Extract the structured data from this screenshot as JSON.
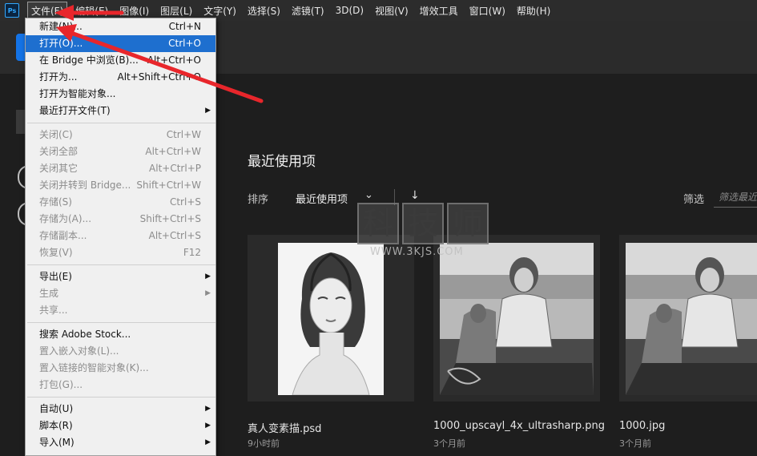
{
  "app": {
    "logo": "Ps"
  },
  "menubar": [
    "文件(F)",
    "编辑(E)",
    "图像(I)",
    "图层(L)",
    "文字(Y)",
    "选择(S)",
    "滤镜(T)",
    "3D(D)",
    "视图(V)",
    "增效工具",
    "窗口(W)",
    "帮助(H)"
  ],
  "home": {
    "section_title": "最近使用项",
    "sort_label": "排序",
    "sort_value": "最近使用项",
    "filter_label": "筛选",
    "filter_placeholder": "筛选最近"
  },
  "files": [
    {
      "name": "真人变素描.psd",
      "time": "9小时前"
    },
    {
      "name": "1000_upscayl_4x_ultrasharp.png",
      "time": "3个月前"
    },
    {
      "name": "1000.jpg",
      "time": "3个月前"
    }
  ],
  "watermark": {
    "chars": [
      "科",
      "技",
      "师"
    ],
    "url": "WWW.3KJS.COM"
  },
  "file_menu": [
    {
      "label": "新建(N)...",
      "shortcut": "Ctrl+N"
    },
    {
      "label": "打开(O)...",
      "shortcut": "Ctrl+O",
      "highlighted": true
    },
    {
      "label": "在 Bridge 中浏览(B)...",
      "shortcut": "Alt+Ctrl+O"
    },
    {
      "label": "打开为...",
      "shortcut": "Alt+Shift+Ctrl+O"
    },
    {
      "label": "打开为智能对象..."
    },
    {
      "label": "最近打开文件(T)",
      "submenu": true
    },
    {
      "separator": true
    },
    {
      "label": "关闭(C)",
      "shortcut": "Ctrl+W",
      "disabled": true
    },
    {
      "label": "关闭全部",
      "shortcut": "Alt+Ctrl+W",
      "disabled": true
    },
    {
      "label": "关闭其它",
      "shortcut": "Alt+Ctrl+P",
      "disabled": true
    },
    {
      "label": "关闭并转到 Bridge...",
      "shortcut": "Shift+Ctrl+W",
      "disabled": true
    },
    {
      "label": "存储(S)",
      "shortcut": "Ctrl+S",
      "disabled": true
    },
    {
      "label": "存储为(A)...",
      "shortcut": "Shift+Ctrl+S",
      "disabled": true
    },
    {
      "label": "存储副本...",
      "shortcut": "Alt+Ctrl+S",
      "disabled": true
    },
    {
      "label": "恢复(V)",
      "shortcut": "F12",
      "disabled": true
    },
    {
      "separator": true
    },
    {
      "label": "导出(E)",
      "submenu": true
    },
    {
      "label": "生成",
      "submenu": true,
      "disabled": true
    },
    {
      "label": "共享...",
      "disabled": true
    },
    {
      "separator": true
    },
    {
      "label": "搜索 Adobe Stock..."
    },
    {
      "label": "置入嵌入对象(L)...",
      "disabled": true
    },
    {
      "label": "置入链接的智能对象(K)...",
      "disabled": true
    },
    {
      "label": "打包(G)...",
      "disabled": true
    },
    {
      "separator": true
    },
    {
      "label": "自动(U)",
      "submenu": true
    },
    {
      "label": "脚本(R)",
      "submenu": true
    },
    {
      "label": "导入(M)",
      "submenu": true
    }
  ],
  "colors": {
    "accent": "#1473e6",
    "highlight": "#1e6fcf",
    "annotation_arrow": "#e8262b"
  }
}
